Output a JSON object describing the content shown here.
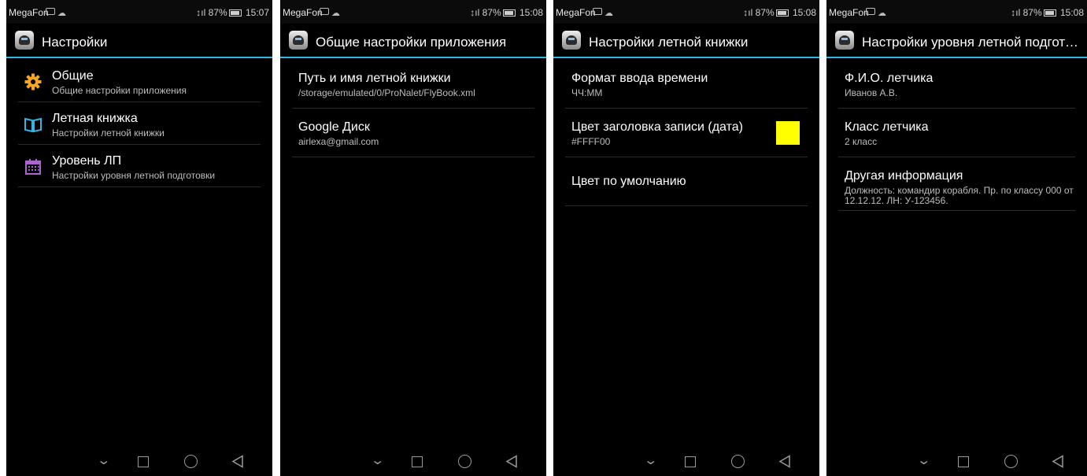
{
  "screens": [
    {
      "status": {
        "carrier": "MegaFon",
        "signal": "↕ıl",
        "battery": "87%",
        "time": "15:07"
      },
      "title": "Настройки",
      "items": [
        {
          "title": "Общие",
          "subtitle": "Общие настройки приложения",
          "icon": "gear-icon",
          "icon_color": "#f5a623"
        },
        {
          "title": "Летная книжка",
          "subtitle": "Настройки летной книжки",
          "icon": "book-icon",
          "icon_color": "#33b5e5"
        },
        {
          "title": "Уровень ЛП",
          "subtitle": "Настройки уровня летной подготовки",
          "icon": "calendar-icon",
          "icon_color": "#aa66cc"
        }
      ]
    },
    {
      "status": {
        "carrier": "MegaFon",
        "signal": "↕ıl",
        "battery": "87%",
        "time": "15:08"
      },
      "title": "Общие настройки приложения",
      "items": [
        {
          "title": "Путь и имя летной книжки",
          "subtitle": "/storage/emulated/0/ProNalet/FlyBook.xml"
        },
        {
          "title": "Google Диск",
          "subtitle": "airlexa@gmail.com"
        }
      ]
    },
    {
      "status": {
        "carrier": "MegaFon",
        "signal": "↕ıl",
        "battery": "87%",
        "time": "15:08"
      },
      "title": "Настройки летной книжки",
      "items": [
        {
          "title": "Формат ввода времени",
          "subtitle": "ЧЧ:ММ"
        },
        {
          "title": "Цвет заголовка записи (дата)",
          "subtitle": "#FFFF00",
          "swatch_color": "#FFFF00"
        },
        {
          "title": "Цвет по умолчанию"
        }
      ]
    },
    {
      "status": {
        "carrier": "MegaFon",
        "signal": "↕ıl",
        "battery": "87%",
        "time": "15:08"
      },
      "title": "Настройки уровня летной подготовки",
      "items": [
        {
          "title": "Ф.И.О. летчика",
          "subtitle": "Иванов А.В."
        },
        {
          "title": "Класс летчика",
          "subtitle": "2 класс"
        },
        {
          "title": "Другая информация",
          "subtitle": "Должность: командир корабля. Пр. по классу 000 от 12.12.12. ЛН: У-123456."
        }
      ]
    }
  ],
  "colors": {
    "accent": "#33b5e5",
    "background": "#000000",
    "nav_icons": "#9a9a9a"
  }
}
